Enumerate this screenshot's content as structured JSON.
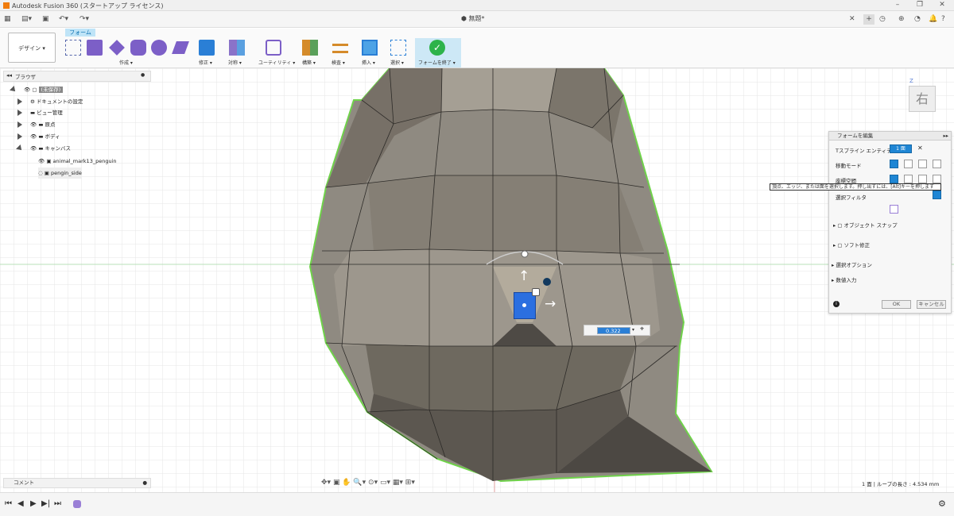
{
  "app": {
    "title": "Autodesk Fusion 360 (スタートアップ ライセンス)",
    "doc_title": "無題*"
  },
  "ribbon": {
    "design_label": "デザイン ▾",
    "form_tab": "フォーム",
    "groups": [
      {
        "label": "作成 ▾"
      },
      {
        "label": "修正 ▾"
      },
      {
        "label": "対称 ▾"
      },
      {
        "label": "ユーティリティ ▾"
      },
      {
        "label": "構築 ▾"
      },
      {
        "label": "検査 ▾"
      },
      {
        "label": "挿入 ▾"
      },
      {
        "label": "選択 ▾"
      },
      {
        "label": "フォームを終了 ▾"
      }
    ]
  },
  "browser": {
    "title": "ブラウザ",
    "items": [
      {
        "label": "(未保存)"
      },
      {
        "label": "ドキュメントの設定"
      },
      {
        "label": "ビュー管理"
      },
      {
        "label": "原点"
      },
      {
        "label": "ボディ"
      },
      {
        "label": "キャンバス"
      },
      {
        "label": "animal_mark13_penguin"
      },
      {
        "label": "pengin_side"
      }
    ]
  },
  "comment_label": "コメント",
  "viewcube_label": "右",
  "viewcube_axis": "Z",
  "value_input": "0.322",
  "edit_panel": {
    "title": "フォームを編集",
    "rows": [
      {
        "label": "Tスプライン エンティティ"
      },
      {
        "label": "移動モード"
      },
      {
        "label": "座標空間"
      },
      {
        "label": "選択フィルタ"
      }
    ],
    "entity_value": "1 面",
    "sections": [
      "オブジェクト スナップ",
      "ソフト修正",
      "選択オプション",
      "数値入力"
    ],
    "ok": "OK",
    "cancel": "キャンセル"
  },
  "tooltip": "頂点、エッジ、または面を選択します。押し出すには、[Alt]キーを押します",
  "status": "1 面 | ループの長さ : 4.534 mm",
  "colors": {
    "accent": "#1f86d4",
    "finish": "#2db34a",
    "mesh": "#8f8a81",
    "outline": "#6fd24a"
  }
}
